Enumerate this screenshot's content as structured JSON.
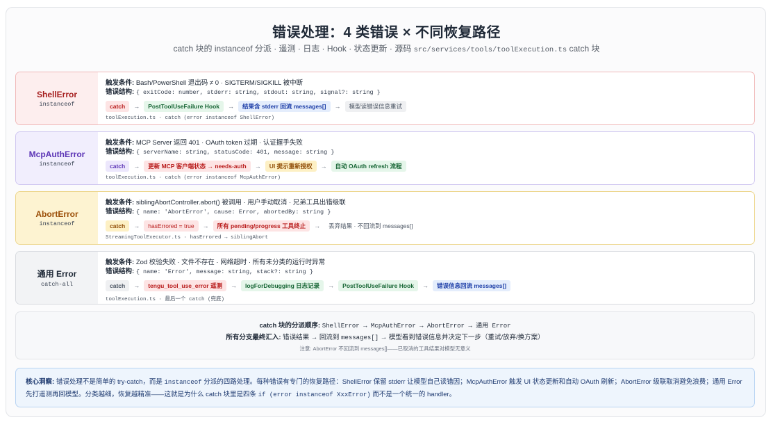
{
  "header": {
    "title": "错误处理：4 类错误 × 不同恢复路径",
    "subtitle_prefix": "catch 块的 instanceof 分派 · 遥测 · 日志 · Hook · 状态更新 · 源码",
    "subtitle_code": "src/services/tools/toolExecution.ts",
    "subtitle_suffix": "catch 块"
  },
  "trigger_label": "触发条件:",
  "struct_label": "错误结构:",
  "arrow": "→",
  "cards": [
    {
      "name": "ShellError",
      "sub": "instanceof",
      "trigger": "Bash/PowerShell 退出码 ≠ 0 · SIGTERM/SIGKILL 被中断",
      "struct": "{ exitCode: number, stderr: string, stdout: string, signal?: string }",
      "chips": [
        {
          "text": "catch",
          "tone": "red"
        },
        {
          "text": "PostToolUseFailure Hook",
          "tone": "green"
        },
        {
          "text": "结果含 stderr 回流 messages[]",
          "tone": "blue"
        },
        {
          "text": "模型读错误信息重试",
          "tone": "gray"
        }
      ],
      "source": "toolExecution.ts · catch (error instanceof ShellError)"
    },
    {
      "name": "McpAuthError",
      "sub": "instanceof",
      "trigger": "MCP Server 返回 401 · OAuth token 过期 · 认证握手失败",
      "struct": "{ serverName: string, statusCode: 401, message: string }",
      "chips": [
        {
          "text": "catch",
          "tone": "purple"
        },
        {
          "text": "更新 MCP 客户端状态 → needs-auth",
          "tone": "red"
        },
        {
          "text": "UI 提示重新授权",
          "tone": "yellow"
        },
        {
          "text": "自动 OAuth refresh 流程",
          "tone": "green"
        }
      ],
      "source": "toolExecution.ts · catch (error instanceof McpAuthError)"
    },
    {
      "name": "AbortError",
      "sub": "instanceof",
      "trigger": "siblingAbortController.abort() 被调用 · 用户手动取消 · 兄弟工具出错级联",
      "struct": "{ name: 'AbortError', cause: Error, abortedBy: string }",
      "chips": [
        {
          "text": "catch",
          "tone": "yellow"
        },
        {
          "text": "hasErrored = true",
          "tone": "red"
        },
        {
          "text": "所有 pending/progress 工具终止",
          "tone": "red"
        },
        {
          "text": "丢弃结果 · 不回流到 messages[]",
          "tone": "plain"
        }
      ],
      "source": "StreamingToolExecutor.ts · hasErrored → siblingAbort"
    },
    {
      "name": "通用 Error",
      "sub": "catch-all",
      "trigger": "Zod 校验失败 · 文件不存在 · 网络超时 · 所有未分类的运行时异常",
      "struct": "{ name: 'Error', message: string, stack?: string }",
      "chips": [
        {
          "text": "catch",
          "tone": "gray"
        },
        {
          "text": "tengu_tool_use_error 遥测",
          "tone": "red"
        },
        {
          "text": "logForDebugging 日志记录",
          "tone": "green"
        },
        {
          "text": "PostToolUseFailure Hook",
          "tone": "green"
        },
        {
          "text": "错误信息回流 messages[]",
          "tone": "blue"
        }
      ],
      "source": "toolExecution.ts · 最后一个 catch (兜底)"
    }
  ],
  "order": {
    "label1": "catch 块的分派顺序:",
    "seq": "ShellError → McpAuthError → AbortError → 通用 Error",
    "label2": "所有分支最终汇入:",
    "r2_a": "错误结果 → 回流到",
    "r2_code": "messages[]",
    "r2_b": "→ 模型看到错误信息并决定下一步（重试/放弃/换方案）",
    "note": "注意: AbortError 不回流到 messages[]——已取消的工具结果对模型无意义"
  },
  "insight": {
    "label": "核心洞察:",
    "t1": "错误处理不是简单的 try-catch，而是",
    "code1": "instanceof",
    "t2": "分派的四路处理。每种错误有专门的恢复路径：ShellError 保留 stderr 让模型自己读错因；McpAuthError 触发 UI 状态更新和自动 OAuth 刷新；AbortError 级联取消避免浪费；通用 Error 先打遥测再回模型。分类越细，恢复越精准——这就是为什么 catch 块里是四条",
    "code2": "if (error instanceof XxxError)",
    "t3": "而不是一个统一的 handler。"
  },
  "colors": {
    "red": "#b91c1c",
    "purple": "#5b34b5",
    "yellow": "#9a4d06",
    "green": "#166534",
    "blue": "#1e3fa8"
  }
}
